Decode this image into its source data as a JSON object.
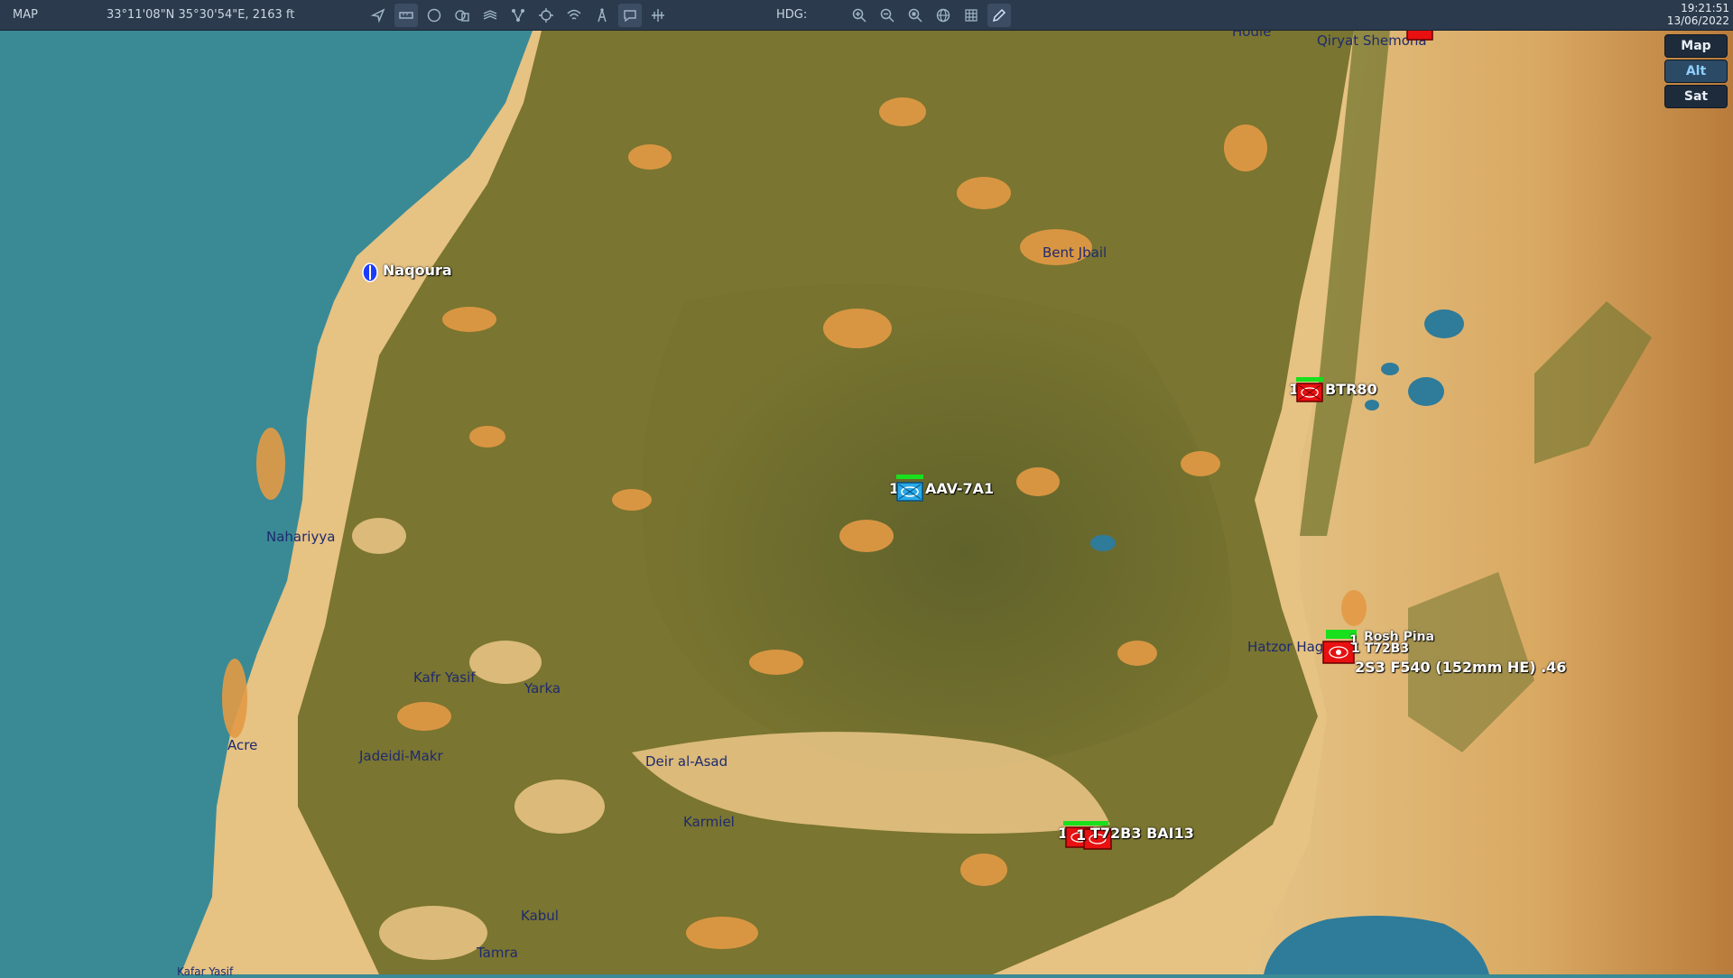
{
  "toolbar": {
    "app_label": "MAP",
    "coordinates": "33°11'08\"N 35°30'54\"E, 2163 ft",
    "hdg_label": "HDG:",
    "icons_left": [
      "navigate-icon",
      "ruler-icon",
      "circle-icon",
      "layers-icon",
      "stack-icon",
      "route-icon",
      "crosshair-icon",
      "signal-icon",
      "tower-icon",
      "chat-icon",
      "sensor-icon"
    ],
    "icons_right": [
      "zoom-in-icon",
      "zoom-out-icon",
      "zoom-fit-icon",
      "globe-icon",
      "grid-icon",
      "pencil-icon"
    ],
    "time": "19:21:51",
    "date": "13/06/2022"
  },
  "layers": {
    "map": "Map",
    "alt": "Alt",
    "sat": "Sat",
    "active": "Alt"
  },
  "places": {
    "hodle": "Hodle",
    "qiryat_shemona": "Qiryat Shemona",
    "bent_jbail": "Bent Jbail",
    "nahariyya": "Nahariyya",
    "kafr_yasif": "Kafr Yasif",
    "yarka": "Yarka",
    "acre": "Acre",
    "jadeidi": "Jadeidi-Makr",
    "deir_al_asad": "Deir al-Asad",
    "karmiel": "Karmiel",
    "kabul": "Kabul",
    "tamra": "Tamra",
    "hatzor": "Hatzor Hag",
    "kafar_yasif_bottom": "Kafar Yasif"
  },
  "units": {
    "naqoura": {
      "label": "Naqoura",
      "color": "#1a3cff"
    },
    "aav": {
      "count": "1",
      "label": "AAV-7A1",
      "color": "#29a9e8"
    },
    "btr": {
      "count": "1",
      "label": "BTR80",
      "color": "#e81010"
    },
    "cluster_rosh": {
      "label1": "Rosh Pina",
      "label2": "1 T72B3",
      "label3": "2S3 F540 (152mm HE) .46",
      "count": "1",
      "color": "#e81010"
    },
    "cluster_bottom": {
      "count1": "1",
      "count2": "1",
      "label": "T72B3 BAI13",
      "color": "#e81010"
    }
  },
  "colors": {
    "sea": "#3a8a95",
    "land_dark": "#6b6a2c",
    "land_sand": "#e8c384",
    "land_orange": "#e39a45",
    "toolbar": "#2b3a4c",
    "lake": "#2f7b9a"
  }
}
